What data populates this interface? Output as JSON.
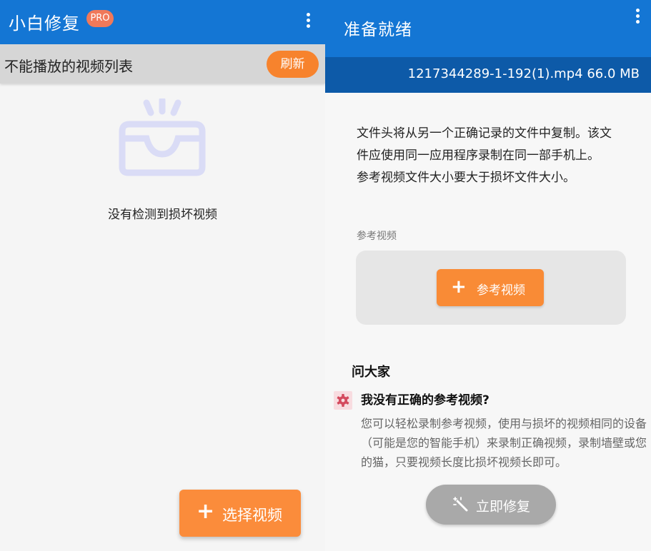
{
  "left": {
    "app_title": "小白修复",
    "pro_badge": "PRO",
    "menu_icon": "more-vert-icon",
    "list_header": "不能播放的视频列表",
    "refresh_label": "刷新",
    "empty_icon": "empty-inbox-icon",
    "empty_text": "没有检测到损坏视频",
    "fab_label": "选择视频",
    "fab_icon": "plus-icon"
  },
  "right": {
    "title": "准备就绪",
    "menu_icon": "more-vert-icon",
    "file_info": "1217344289-1-192(1).mp4  66.0 MB",
    "description": {
      "line1": "文件头将从另一个正确记录的文件中复制。该文件应使用同一应用程序录制在同一部手机上。",
      "line2": "参考视频文件大小要大于损坏文件大小。"
    },
    "reference_label": "参考视频",
    "reference_button": "参考视频",
    "ask_title": "问大家",
    "faq": {
      "icon": "gear-icon",
      "question": "我没有正确的参考视频?",
      "answer": "您可以轻松录制参考视频，使用与损坏的视频相同的设备（可能是您的智能手机）来录制正确视频，录制墙壁或您的猫，只要视频长度比损坏视频长即可。"
    },
    "fix_button": "立即修复",
    "fix_icon": "magic-wand-icon"
  },
  "colors": {
    "primary": "#1476d4",
    "primary_dark": "#0d5aa8",
    "accent": "#f7832d",
    "badge": "#f0795a",
    "disabled": "#a9a9a9"
  }
}
